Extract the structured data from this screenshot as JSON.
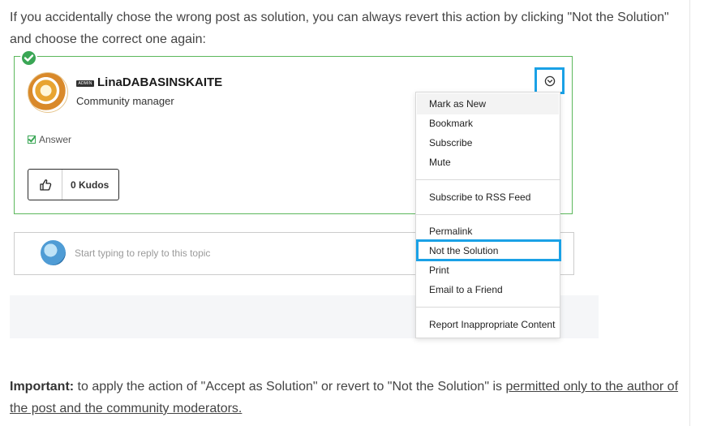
{
  "intro_text": "If you accidentally chose the wrong post as solution, you can always revert this action by clicking \"Not the Solution\" and choose the correct one again:",
  "post": {
    "author_name": "LinaDABASINSKAITE",
    "author_role": "Community manager",
    "rank_badge": "ADMIN",
    "answer_label": "Answer",
    "kudos_label": "0 Kudos"
  },
  "menu": {
    "items": [
      "Mark as New",
      "Bookmark",
      "Subscribe",
      "Mute",
      "Subscribe to RSS Feed",
      "Permalink",
      "Not the Solution",
      "Print",
      "Email to a Friend",
      "Report Inappropriate Content"
    ]
  },
  "reply": {
    "placeholder": "Start typing to reply to this topic"
  },
  "important": {
    "label": "Important:",
    "text": " to apply the action of \"Accept as Solution\" or revert to \"Not the Solution\" is ",
    "link_text": "permitted only to the author of the post and the community moderators."
  },
  "colors": {
    "solution_green": "#5cb85c",
    "highlight_blue": "#1aa1e6"
  },
  "icons": [
    "checkmark-badge-icon",
    "options-chevron-icon",
    "thumbs-up-icon",
    "answer-check-icon"
  ]
}
